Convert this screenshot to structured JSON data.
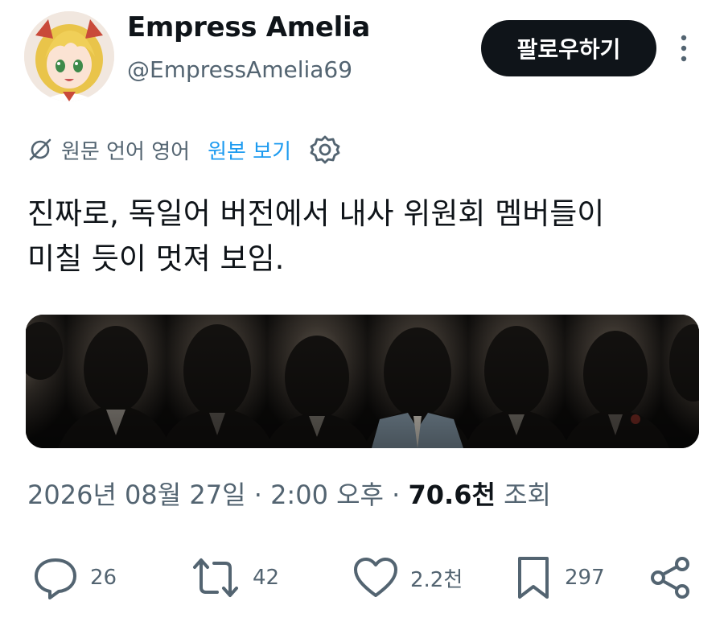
{
  "user": {
    "display_name": "Empress Amelia",
    "handle": "@EmpressAmelia69",
    "follow_label": "팔로우하기"
  },
  "translation": {
    "note": "원문 언어 영어",
    "show_original": "원본 보기"
  },
  "tweet": {
    "line1": "진짜로, 독일어 버전에서 내사 위원회 멤버들이",
    "line2": "미칠 듯이 멋져 보임."
  },
  "meta": {
    "date": "2026년 08월 27일",
    "separator1": " · ",
    "time": "2:00 오후",
    "separator2": " · ",
    "views_count": "70.6천",
    "views_label": " 조회"
  },
  "actions": {
    "replies": "26",
    "reposts": "42",
    "likes": "2.2천",
    "bookmarks": "297"
  },
  "colors": {
    "accent": "#1d9bf0",
    "text_primary": "#0f1419",
    "text_secondary": "#536471",
    "button_bg": "#0f1419"
  },
  "icons": [
    "more-vertical-icon",
    "translate-icon",
    "gear-icon",
    "reply-icon",
    "repost-icon",
    "like-icon",
    "bookmark-icon",
    "share-icon"
  ]
}
